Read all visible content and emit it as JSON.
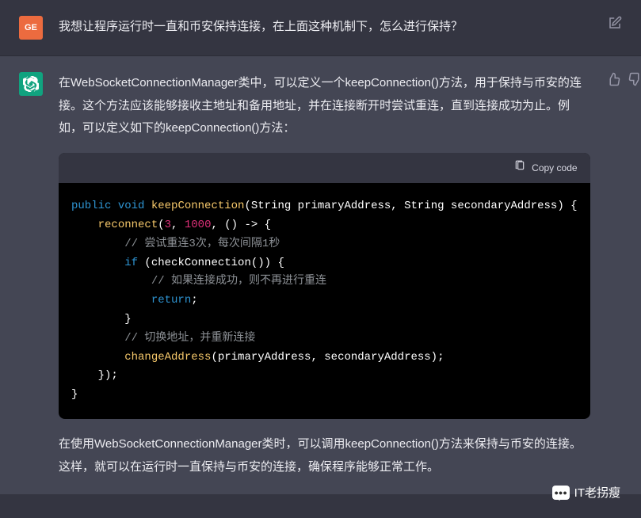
{
  "user": {
    "avatar_text": "GE",
    "message": "我想让程序运行时一直和币安保持连接，在上面这种机制下，怎么进行保持？"
  },
  "assistant": {
    "intro": "在WebSocketConnectionManager类中，可以定义一个keepConnection()方法，用于保持与币安的连接。这个方法应该能够接收主地址和备用地址，并在连接断开时尝试重连，直到连接成功为止。例如，可以定义如下的keepConnection()方法：",
    "outro": "在使用WebSocketConnectionManager类时，可以调用keepConnection()方法来保持与币安的连接。这样，就可以在运行时一直保持与币安的连接，确保程序能够正常工作。"
  },
  "code": {
    "copy_label": "Copy code",
    "kw_public": "public",
    "kw_void": "void",
    "fn_keep": "keepConnection",
    "sig_tail": "(String primaryAddress, String secondaryAddress) {",
    "fn_reconnect": "reconnect",
    "num_3": "3",
    "num_1000": "1000",
    "lambda_tail": ", () -> {",
    "cm1": "// 尝试重连3次，每次间隔1秒",
    "kw_if": "if",
    "if_cond": " (checkConnection()) {",
    "cm2": "// 如果连接成功，则不再进行重连",
    "kw_return": "return",
    "semi": ";",
    "brace_close": "}",
    "cm3": "// 切换地址，并重新连接",
    "fn_change": "changeAddress",
    "change_args": "(primaryAddress, secondaryAddress);",
    "lambda_end": "});"
  },
  "watermark": {
    "text": "IT老拐瘦",
    "bubble": "●●●"
  }
}
